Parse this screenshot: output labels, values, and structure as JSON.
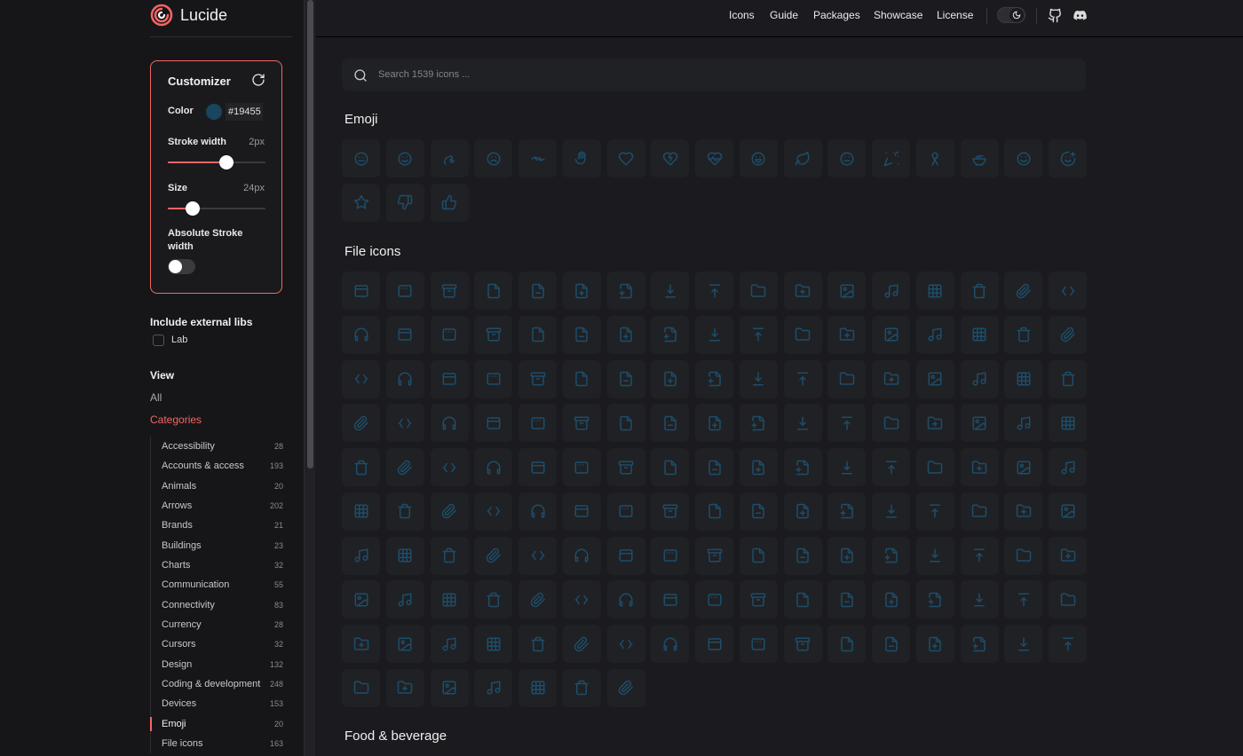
{
  "app": {
    "name": "Lucide"
  },
  "nav": {
    "links": [
      "Icons",
      "Guide",
      "Packages",
      "Showcase",
      "License"
    ],
    "icons": [
      "moon-icon",
      "github-icon",
      "discord-icon"
    ]
  },
  "customizer": {
    "title": "Customizer",
    "color_label": "Color",
    "color_value": "#19455",
    "color_hex": "#19455f",
    "stroke_label": "Stroke width",
    "stroke_value": "2px",
    "stroke_fraction": 0.6,
    "size_label": "Size",
    "size_value": "24px",
    "size_fraction": 0.25,
    "absolute_label": "Absolute Stroke width",
    "absolute_on": false
  },
  "external": {
    "heading": "Include external libs",
    "lab": "Lab"
  },
  "view": {
    "heading": "View",
    "all": "All",
    "categories": "Categories"
  },
  "categories": [
    {
      "label": "Accessibility",
      "count": "28"
    },
    {
      "label": "Accounts & access",
      "count": "193"
    },
    {
      "label": "Animals",
      "count": "20"
    },
    {
      "label": "Arrows",
      "count": "202"
    },
    {
      "label": "Brands",
      "count": "21"
    },
    {
      "label": "Buildings",
      "count": "23"
    },
    {
      "label": "Charts",
      "count": "32"
    },
    {
      "label": "Communication",
      "count": "55"
    },
    {
      "label": "Connectivity",
      "count": "83"
    },
    {
      "label": "Currency",
      "count": "28"
    },
    {
      "label": "Cursors",
      "count": "32"
    },
    {
      "label": "Design",
      "count": "132"
    },
    {
      "label": "Coding & development",
      "count": "248"
    },
    {
      "label": "Devices",
      "count": "153"
    },
    {
      "label": "Emoji",
      "count": "20",
      "active": true
    },
    {
      "label": "File icons",
      "count": "163"
    }
  ],
  "search": {
    "placeholder": "Search 1539 icons ..."
  },
  "sections": [
    {
      "title": "Emoji",
      "count": 20
    },
    {
      "title": "File icons",
      "count": 163
    },
    {
      "title": "Food & beverage",
      "count": 0
    }
  ],
  "colors": {
    "accent": "#f56565",
    "icon_stroke": "#1d4d6a",
    "tile": "#202124"
  }
}
